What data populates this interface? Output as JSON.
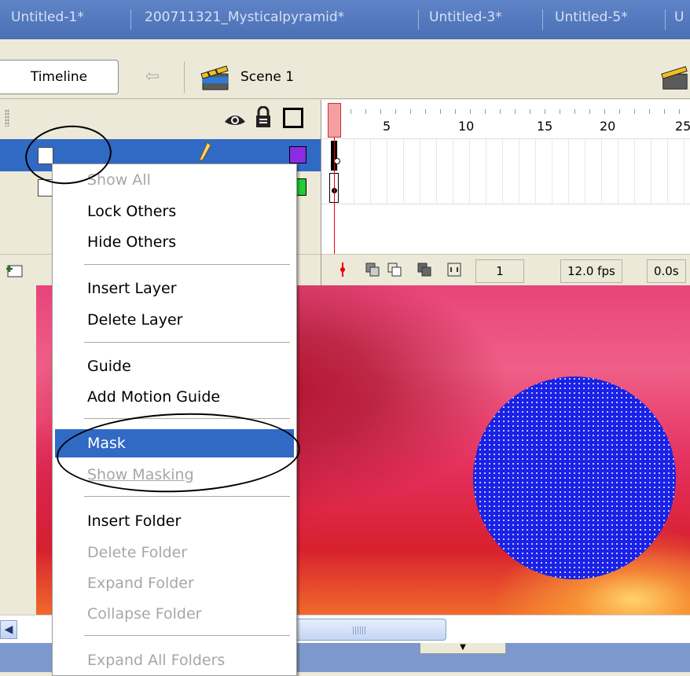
{
  "document_tabs": [
    "Untitled-1*",
    "200711321_Mysticalpyramid*",
    "Untitled-3*",
    "Untitled-5*",
    "U"
  ],
  "toolbar": {
    "timeline_label": "Timeline",
    "scene_label": "Scene 1"
  },
  "timeline": {
    "frame_numbers": [
      "1",
      "5",
      "10",
      "15",
      "20",
      "25"
    ],
    "current_frame": "1",
    "frame_rate": "12.0 fps",
    "elapsed_time": "0.0s"
  },
  "layers": [
    {
      "selected": true,
      "color": "#8b2be2"
    },
    {
      "selected": false,
      "color": "#22cc33"
    }
  ],
  "context_menu": {
    "items": [
      {
        "label": "Show All",
        "enabled": false
      },
      {
        "label": "Lock Others",
        "enabled": true
      },
      {
        "label": "Hide Others",
        "enabled": true
      },
      {
        "label": "Insert Layer",
        "enabled": true
      },
      {
        "label": "Delete Layer",
        "enabled": true
      },
      {
        "label": "Guide",
        "enabled": true
      },
      {
        "label": "Add Motion Guide",
        "enabled": true
      },
      {
        "label": "Mask",
        "enabled": true,
        "highlighted": true
      },
      {
        "label": "Show Masking",
        "enabled": false
      },
      {
        "label": "Insert Folder",
        "enabled": true
      },
      {
        "label": "Delete Folder",
        "enabled": false
      },
      {
        "label": "Expand Folder",
        "enabled": false
      },
      {
        "label": "Collapse Folder",
        "enabled": false
      },
      {
        "label": "Expand All Folders",
        "enabled": false
      }
    ]
  },
  "colors": {
    "tab_bar": "#4a6fb4",
    "selection": "#316ac5",
    "mask_circle": "#1a22e6",
    "panel": "#ece9d8"
  },
  "icons": [
    "eye-icon",
    "lock-icon",
    "outline-icon",
    "scene-clapper-icon",
    "back-arrow-icon",
    "add-layer-icon",
    "scroll-left-arrow-icon",
    "collapse-arrow-icon"
  ]
}
